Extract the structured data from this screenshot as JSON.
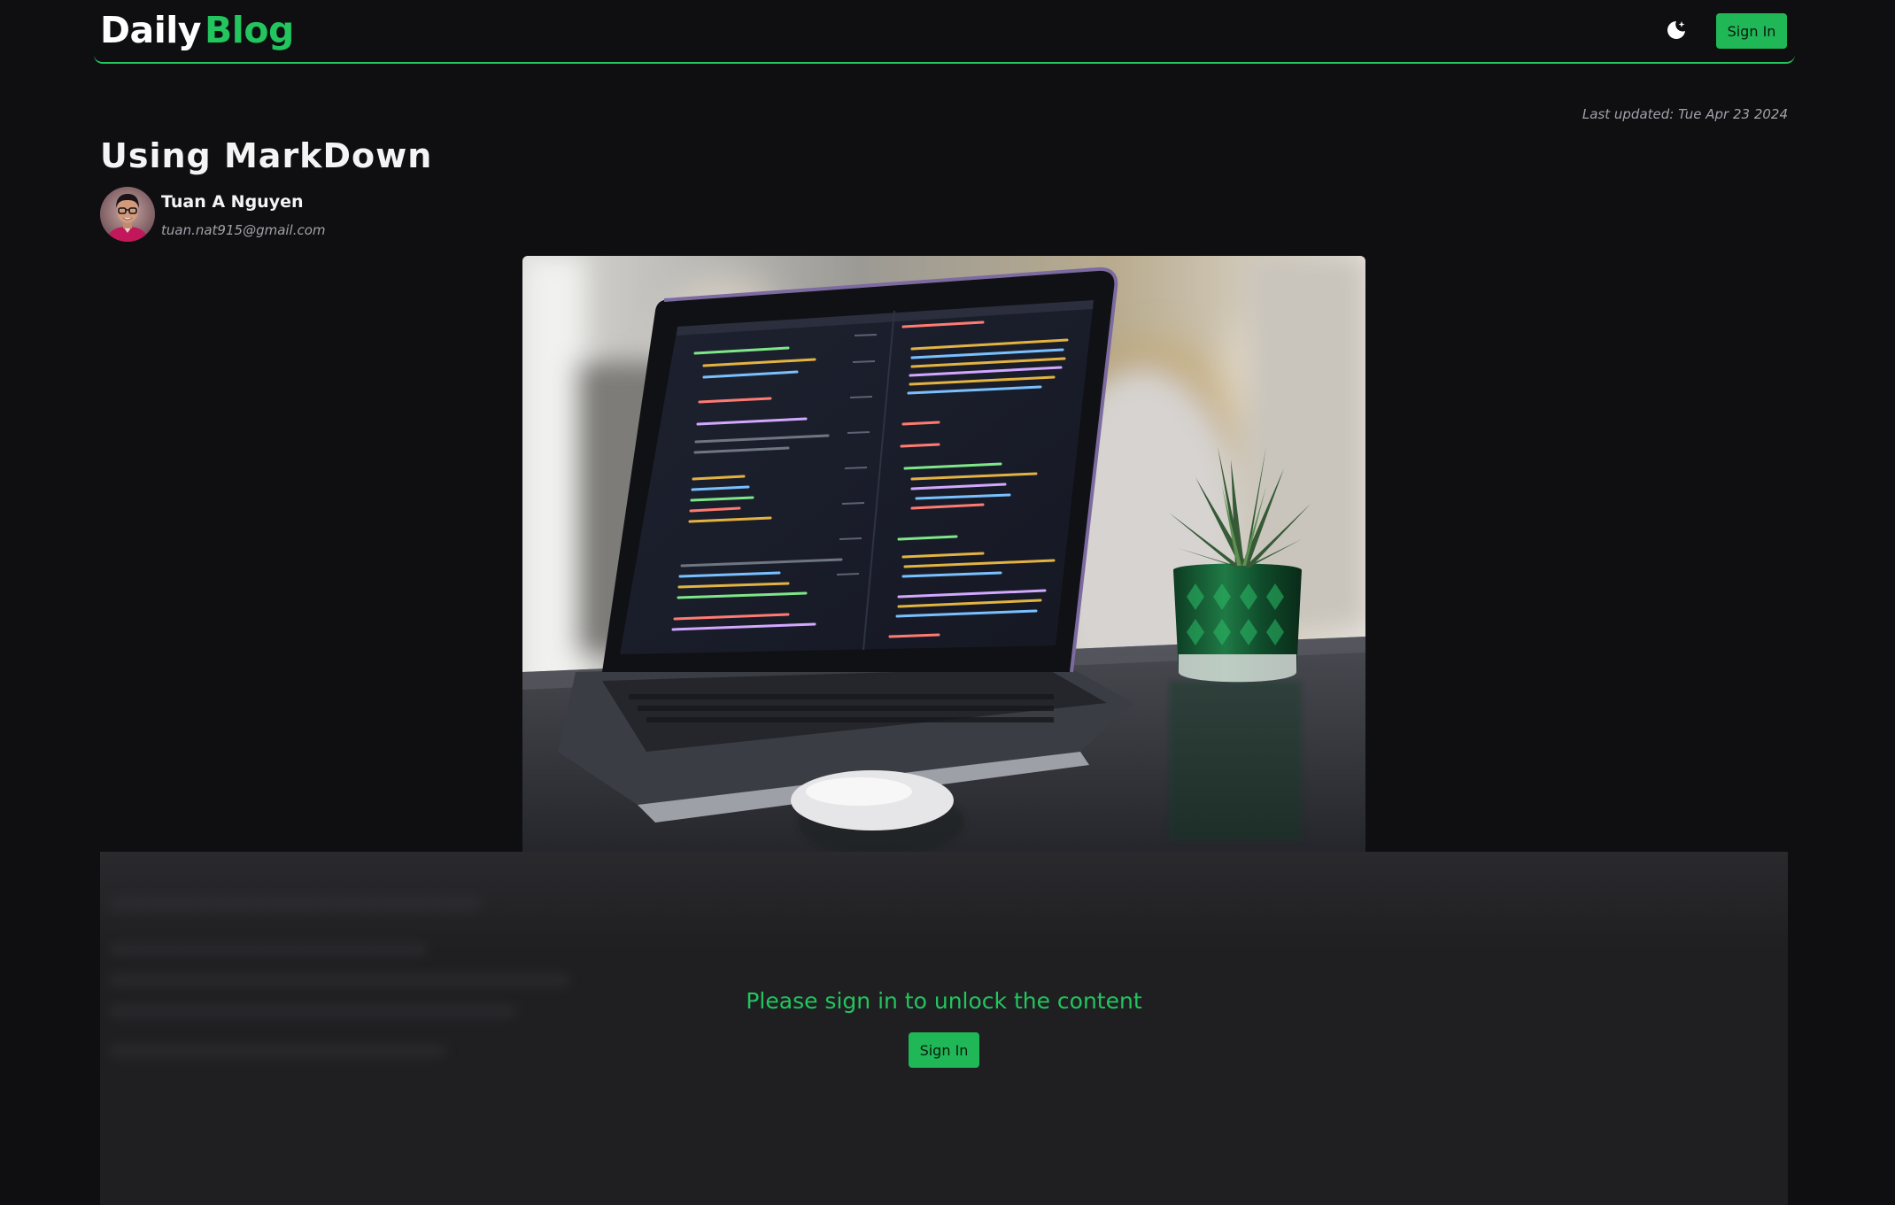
{
  "header": {
    "logo_part1": "Daily",
    "logo_part2": "Blog",
    "theme_toggle_icon": "moon-stars-icon",
    "signin_label": "Sign In"
  },
  "post": {
    "last_updated": "Last updated: Tue Apr 23 2024",
    "title": "Using MarkDown",
    "author_name": "Tuan A Nguyen",
    "author_email": "tuan.nat915@gmail.com",
    "cover_image": "laptop-with-code-and-plant-photo"
  },
  "paywall": {
    "message": "Please sign in to unlock the content",
    "signin_label": "Sign In"
  },
  "colors": {
    "background": "#0f0f11",
    "accent": "#22c55e",
    "panel": "#1f1f22"
  }
}
